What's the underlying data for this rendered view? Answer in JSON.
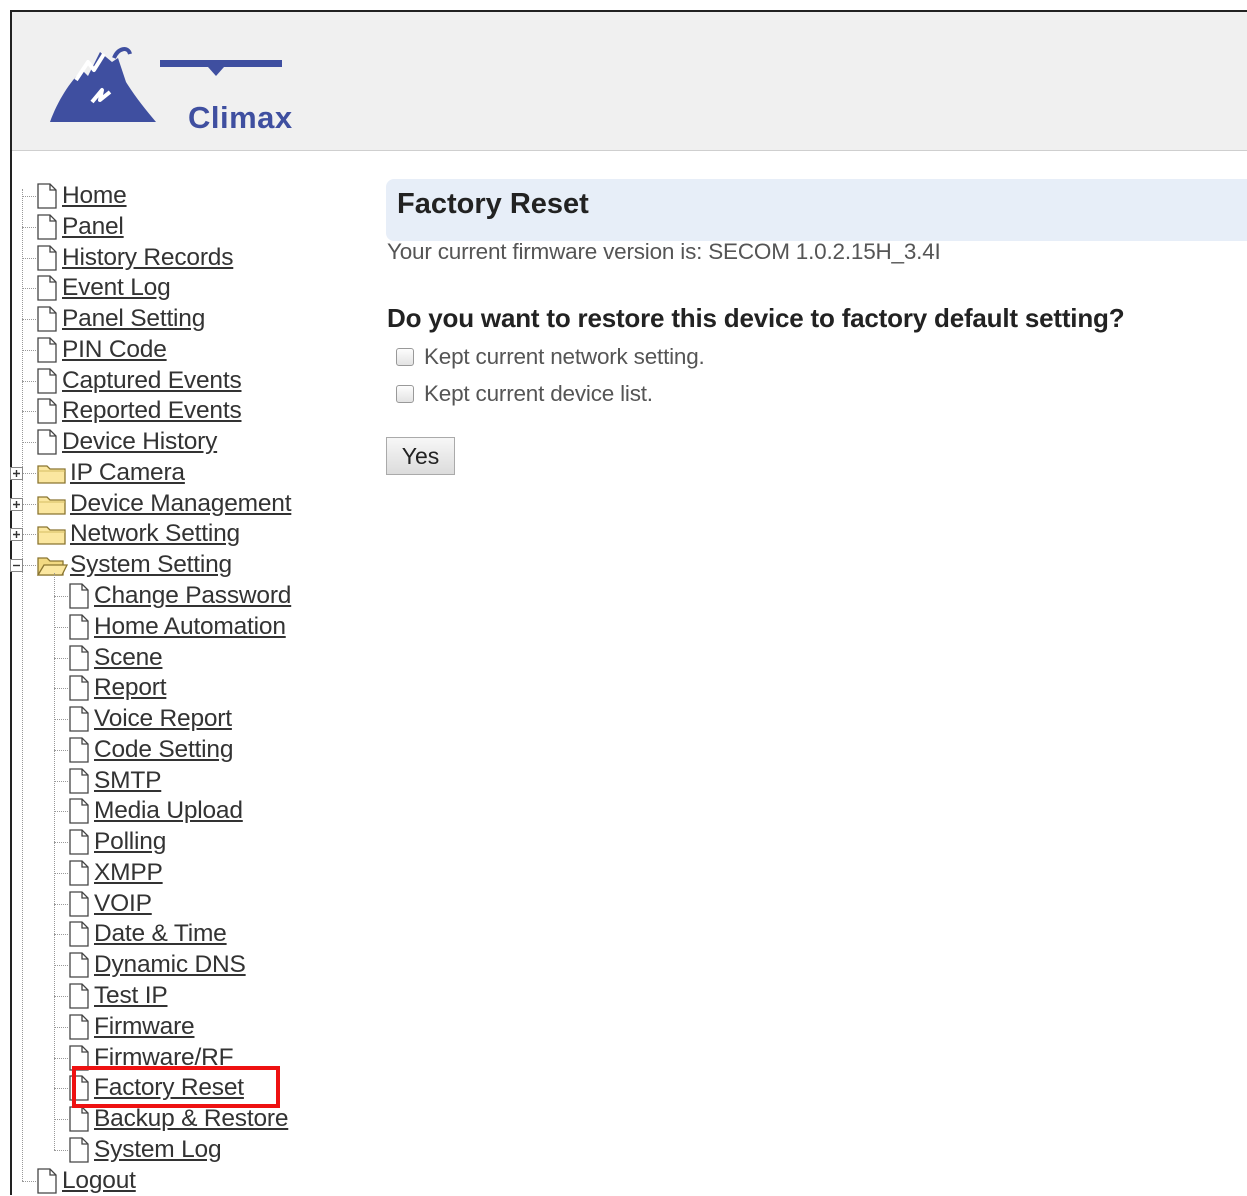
{
  "brand": {
    "name": "Climax"
  },
  "nav": {
    "top_items": [
      {
        "label": "Home"
      },
      {
        "label": "Panel"
      },
      {
        "label": "History Records"
      },
      {
        "label": "Event Log"
      },
      {
        "label": "Panel Setting"
      },
      {
        "label": "PIN Code"
      },
      {
        "label": "Captured Events"
      },
      {
        "label": "Reported Events"
      },
      {
        "label": "Device History"
      }
    ],
    "folders": [
      {
        "label": "IP Camera",
        "state": "collapsed"
      },
      {
        "label": "Device Management",
        "state": "collapsed"
      },
      {
        "label": "Network Setting",
        "state": "collapsed"
      },
      {
        "label": "System Setting",
        "state": "expanded"
      }
    ],
    "system_children": [
      {
        "label": "Change Password"
      },
      {
        "label": "Home Automation"
      },
      {
        "label": "Scene"
      },
      {
        "label": "Report"
      },
      {
        "label": "Voice Report"
      },
      {
        "label": "Code Setting"
      },
      {
        "label": "SMTP"
      },
      {
        "label": "Media Upload"
      },
      {
        "label": "Polling"
      },
      {
        "label": "XMPP"
      },
      {
        "label": "VOIP"
      },
      {
        "label": "Date & Time"
      },
      {
        "label": "Dynamic DNS"
      },
      {
        "label": "Test IP"
      },
      {
        "label": "Firmware"
      },
      {
        "label": "Firmware/RF"
      },
      {
        "label": "Factory Reset",
        "highlighted": true
      },
      {
        "label": "Backup & Restore"
      },
      {
        "label": "System Log"
      }
    ],
    "logout": {
      "label": "Logout"
    },
    "highlight_color": "#ee1111"
  },
  "main": {
    "title": "Factory Reset",
    "firmware_text": "Your current firmware version is: SECOM 1.0.2.15H_3.4I",
    "question": "Do you want to restore this device to factory default setting?",
    "options": [
      {
        "label": "Kept current network setting.",
        "checked": false
      },
      {
        "label": "Kept current device list.",
        "checked": false
      }
    ],
    "yes_label": "Yes",
    "title_bar_color": "#e7eef8"
  }
}
